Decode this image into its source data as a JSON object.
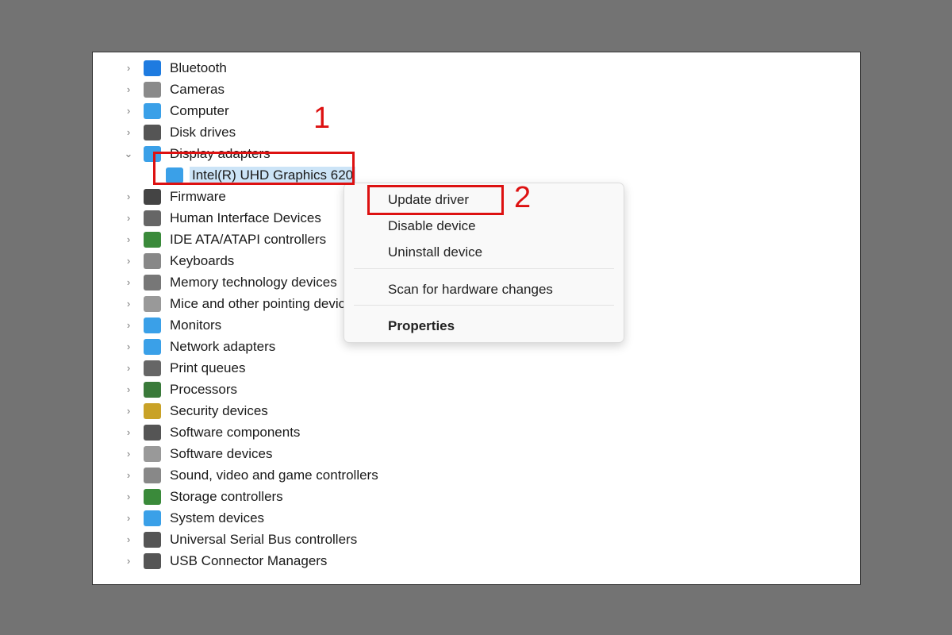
{
  "tree": [
    {
      "label": "Bluetooth",
      "icon": "bluetooth-icon",
      "color": "#1e7be0",
      "expanded": false
    },
    {
      "label": "Cameras",
      "icon": "camera-icon",
      "color": "#8a8a8a",
      "expanded": false
    },
    {
      "label": "Computer",
      "icon": "computer-icon",
      "color": "#3aa0e8",
      "expanded": false
    },
    {
      "label": "Disk drives",
      "icon": "disk-drive-icon",
      "color": "#555555",
      "expanded": false
    },
    {
      "label": "Display adapters",
      "icon": "display-adapter-icon",
      "color": "#3aa0e8",
      "expanded": true
    },
    {
      "label": "Intel(R) UHD Graphics 620",
      "icon": "display-adapter-icon",
      "color": "#3aa0e8",
      "child": true,
      "selected": true
    },
    {
      "label": "Firmware",
      "icon": "firmware-icon",
      "color": "#444444",
      "expanded": false
    },
    {
      "label": "Human Interface Devices",
      "icon": "hid-icon",
      "color": "#666666",
      "expanded": false
    },
    {
      "label": "IDE ATA/ATAPI controllers",
      "icon": "ide-controller-icon",
      "color": "#3a8a3a",
      "expanded": false
    },
    {
      "label": "Keyboards",
      "icon": "keyboard-icon",
      "color": "#888888",
      "expanded": false
    },
    {
      "label": "Memory technology devices",
      "icon": "memory-icon",
      "color": "#777777",
      "expanded": false
    },
    {
      "label": "Mice and other pointing devices",
      "icon": "mouse-icon",
      "color": "#999999",
      "expanded": false
    },
    {
      "label": "Monitors",
      "icon": "monitor-icon",
      "color": "#3aa0e8",
      "expanded": false
    },
    {
      "label": "Network adapters",
      "icon": "network-adapter-icon",
      "color": "#3aa0e8",
      "expanded": false
    },
    {
      "label": "Print queues",
      "icon": "printer-icon",
      "color": "#666666",
      "expanded": false
    },
    {
      "label": "Processors",
      "icon": "processor-icon",
      "color": "#3a7a3a",
      "expanded": false
    },
    {
      "label": "Security devices",
      "icon": "security-device-icon",
      "color": "#c9a227",
      "expanded": false
    },
    {
      "label": "Software components",
      "icon": "software-component-icon",
      "color": "#555555",
      "expanded": false
    },
    {
      "label": "Software devices",
      "icon": "software-device-icon",
      "color": "#999999",
      "expanded": false
    },
    {
      "label": "Sound, video and game controllers",
      "icon": "speaker-icon",
      "color": "#888888",
      "expanded": false
    },
    {
      "label": "Storage controllers",
      "icon": "storage-controller-icon",
      "color": "#3a8a3a",
      "expanded": false
    },
    {
      "label": "System devices",
      "icon": "system-device-icon",
      "color": "#3aa0e8",
      "expanded": false
    },
    {
      "label": "Universal Serial Bus controllers",
      "icon": "usb-icon",
      "color": "#555555",
      "expanded": false
    },
    {
      "label": "USB Connector Managers",
      "icon": "usb-icon",
      "color": "#555555",
      "expanded": false
    }
  ],
  "context_menu": {
    "update": "Update driver",
    "disable": "Disable device",
    "uninstall": "Uninstall device",
    "scan": "Scan for hardware changes",
    "properties": "Properties"
  },
  "annotations": {
    "step1": "1",
    "step2": "2",
    "color": "#dd1111"
  }
}
